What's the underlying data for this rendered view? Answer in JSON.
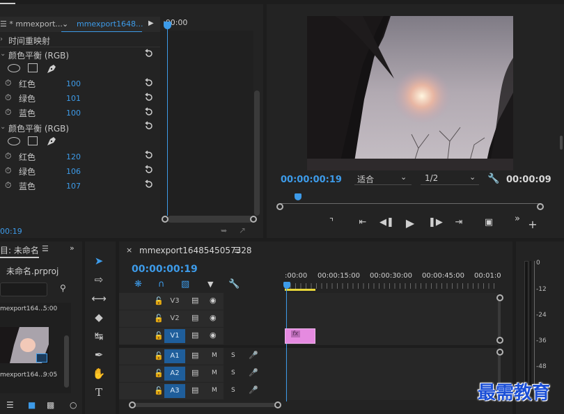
{
  "effect_controls": {
    "tab_label": "mmexport1648...",
    "source_partial": "☰ * mmexport...",
    "timecode_ruler": ":00:00",
    "time_remap_label": "时间重映射",
    "current_time": "00:19",
    "effects": [
      {
        "name": "颜色平衡 (RGB)",
        "params": [
          {
            "label": "红色",
            "value": "100"
          },
          {
            "label": "绿色",
            "value": "101"
          },
          {
            "label": "蓝色",
            "value": "100"
          }
        ]
      },
      {
        "name": "颜色平衡 (RGB)",
        "params": [
          {
            "label": "红色",
            "value": "120"
          },
          {
            "label": "绿色",
            "value": "106"
          },
          {
            "label": "蓝色",
            "value": "107"
          }
        ]
      }
    ]
  },
  "program_monitor": {
    "timecode": "00:00:00:19",
    "fit_label": "适合",
    "resolution": "1/2",
    "duration": "00:00:09"
  },
  "project": {
    "tab_label": "目: 未命名",
    "project_file": "未命名.prproj",
    "item1_name": "mexport164...",
    "item1_duration": "5:00",
    "item2_name": "mexport164...",
    "item2_duration": "9:05"
  },
  "timeline": {
    "tab_label": "mmexport1648545057328",
    "timecode": "00:00:00:19",
    "ruler_labels": [
      ":00:00",
      "00:00:15:00",
      "00:00:30:00",
      "00:00:45:00",
      "00:01:0"
    ],
    "clip_label": "fx",
    "video_tracks": [
      "V3",
      "V2",
      "V1"
    ],
    "audio_tracks": [
      "A1",
      "A2",
      "A3"
    ],
    "mute_label": "M",
    "solo_label": "S"
  },
  "audio_meter": {
    "scale": [
      "0",
      "-12",
      "-24",
      "-36",
      "-48"
    ]
  },
  "watermark": "最需教育",
  "colors": {
    "accent": "#3d9be9",
    "clip": "#e58ae0",
    "work_area": "#e8d63a",
    "active_track": "#1f5e9b"
  }
}
